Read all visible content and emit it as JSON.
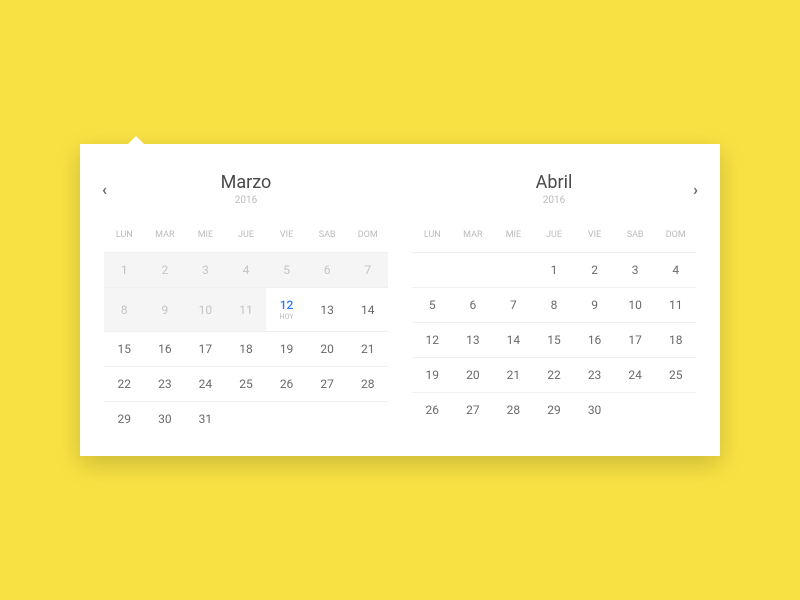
{
  "todayLabel": "HOY",
  "nav": {
    "prev": "‹",
    "next": "›"
  },
  "months": [
    {
      "name": "Marzo",
      "year": "2016",
      "weekdays": [
        "LUN",
        "MAR",
        "MIE",
        "JUE",
        "VIE",
        "SAB",
        "DOM"
      ],
      "weeks": [
        [
          {
            "day": 1,
            "past": true
          },
          {
            "day": 2,
            "past": true
          },
          {
            "day": 3,
            "past": true
          },
          {
            "day": 4,
            "past": true
          },
          {
            "day": 5,
            "past": true
          },
          {
            "day": 6,
            "past": true
          },
          {
            "day": 7,
            "past": true
          }
        ],
        [
          {
            "day": 8,
            "past": true
          },
          {
            "day": 9,
            "past": true
          },
          {
            "day": 10,
            "past": true
          },
          {
            "day": 11,
            "past": true
          },
          {
            "day": 12,
            "today": true
          },
          {
            "day": 13
          },
          {
            "day": 14
          }
        ],
        [
          {
            "day": 15
          },
          {
            "day": 16
          },
          {
            "day": 17
          },
          {
            "day": 18
          },
          {
            "day": 19
          },
          {
            "day": 20
          },
          {
            "day": 21
          }
        ],
        [
          {
            "day": 22
          },
          {
            "day": 23
          },
          {
            "day": 24
          },
          {
            "day": 25
          },
          {
            "day": 26
          },
          {
            "day": 27
          },
          {
            "day": 28
          }
        ],
        [
          {
            "day": 29
          },
          {
            "day": 30
          },
          {
            "day": 31
          },
          {
            "empty": true
          },
          {
            "empty": true
          },
          {
            "empty": true
          },
          {
            "empty": true
          }
        ]
      ]
    },
    {
      "name": "Abril",
      "year": "2016",
      "weekdays": [
        "LUN",
        "MAR",
        "MIE",
        "JUE",
        "VIE",
        "SAB",
        "DOM"
      ],
      "weeks": [
        [
          {
            "empty": true
          },
          {
            "empty": true
          },
          {
            "empty": true
          },
          {
            "day": 1
          },
          {
            "day": 2
          },
          {
            "day": 3
          },
          {
            "day": 4
          }
        ],
        [
          {
            "day": 5
          },
          {
            "day": 6
          },
          {
            "day": 7
          },
          {
            "day": 8
          },
          {
            "day": 9
          },
          {
            "day": 10
          },
          {
            "day": 11
          }
        ],
        [
          {
            "day": 12
          },
          {
            "day": 13
          },
          {
            "day": 14
          },
          {
            "day": 15
          },
          {
            "day": 16
          },
          {
            "day": 17
          },
          {
            "day": 18
          }
        ],
        [
          {
            "day": 19
          },
          {
            "day": 20
          },
          {
            "day": 21
          },
          {
            "day": 22
          },
          {
            "day": 23
          },
          {
            "day": 24
          },
          {
            "day": 25
          }
        ],
        [
          {
            "day": 26
          },
          {
            "day": 27
          },
          {
            "day": 28
          },
          {
            "day": 29
          },
          {
            "day": 30
          },
          {
            "empty": true
          },
          {
            "empty": true
          }
        ]
      ]
    }
  ]
}
